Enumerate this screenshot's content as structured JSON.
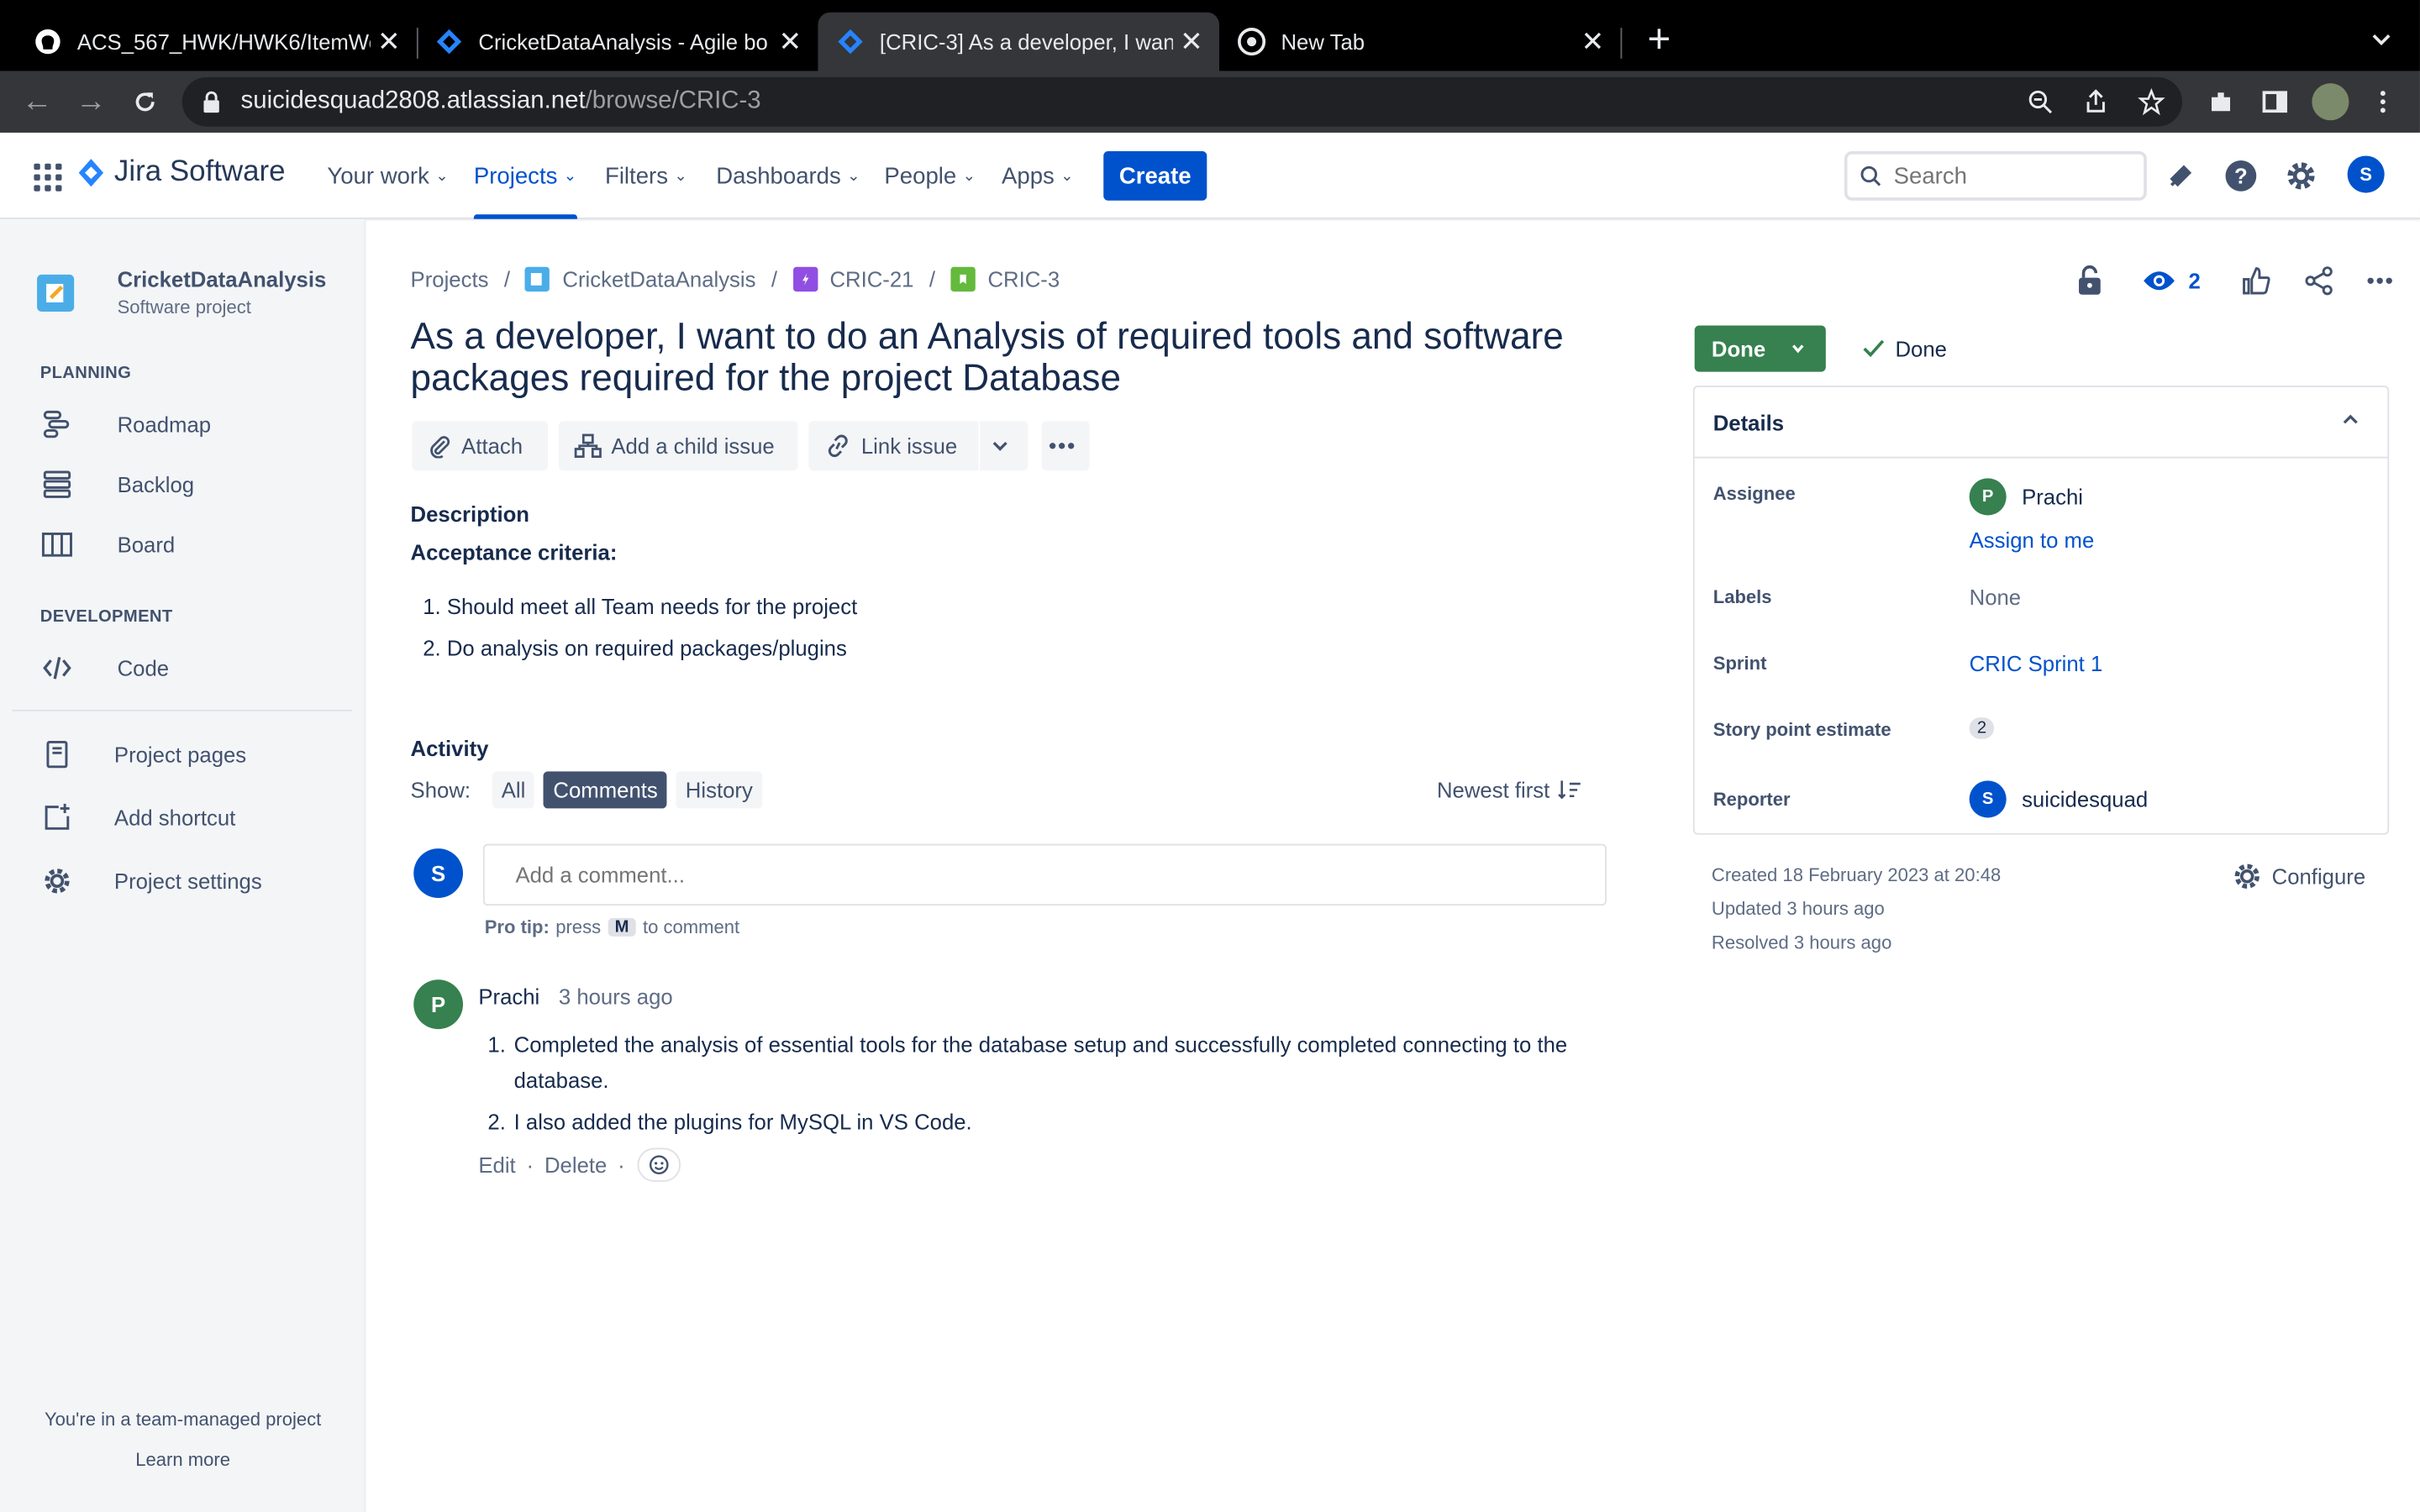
{
  "browser": {
    "tabs": [
      {
        "title": "ACS_567_HWK/HWK6/ItemWe",
        "icon": "github-icon"
      },
      {
        "title": "CricketDataAnalysis - Agile bo",
        "icon": "jira-icon"
      },
      {
        "title": "[CRIC-3] As a developer, I wan",
        "icon": "jira-icon",
        "active": true
      },
      {
        "title": "New Tab",
        "icon": "chrome-icon"
      }
    ],
    "url_host": "suicidesquad2808.atlassian.net",
    "url_path": "/browse/CRIC-3"
  },
  "topnav": {
    "product": "Jira Software",
    "items": [
      "Your work",
      "Projects",
      "Filters",
      "Dashboards",
      "People",
      "Apps"
    ],
    "create": "Create",
    "search_placeholder": "Search",
    "user_initial": "S"
  },
  "sidebar": {
    "project_name": "CricketDataAnalysis",
    "project_type": "Software project",
    "planning_header": "PLANNING",
    "planning": [
      "Roadmap",
      "Backlog",
      "Board"
    ],
    "development_header": "DEVELOPMENT",
    "development": [
      "Code"
    ],
    "links": [
      "Project pages",
      "Add shortcut",
      "Project settings"
    ],
    "footer_text": "You're in a team-managed project",
    "footer_link": "Learn more"
  },
  "issue": {
    "breadcrumbs": [
      "Projects",
      "CricketDataAnalysis",
      "CRIC-21",
      "CRIC-3"
    ],
    "title": "As a developer, I want to do an Analysis of required tools and software packages required for the project Database",
    "actions": [
      "Attach",
      "Add a child issue",
      "Link issue"
    ],
    "description_header": "Description",
    "acceptance": "Acceptance criteria:",
    "criteria": [
      "1. Should meet all Team needs for the project",
      "2. Do analysis on required packages/plugins"
    ],
    "watchers": "2",
    "status": "Done",
    "resolution": "Done"
  },
  "activity": {
    "header": "Activity",
    "show_label": "Show:",
    "filters": [
      "All",
      "Comments",
      "History"
    ],
    "active_filter": "Comments",
    "sort": "Newest first",
    "comment_placeholder": "Add a comment...",
    "protip_label": "Pro tip:",
    "protip_pre": "press",
    "protip_key": "M",
    "protip_post": "to comment",
    "comment": {
      "author": "Prachi",
      "author_initial": "P",
      "time": "3 hours ago",
      "items": [
        {
          "n": "1.",
          "text": "Completed the analysis of essential tools for the database setup and successfully completed connecting to the database."
        },
        {
          "n": "2.",
          "text": "I also added the plugins for MySQL in VS Code."
        }
      ],
      "edit": "Edit",
      "delete": "Delete"
    }
  },
  "details": {
    "header": "Details",
    "assignee_label": "Assignee",
    "assignee": "Prachi",
    "assignee_initial": "P",
    "assign_to_me": "Assign to me",
    "labels_label": "Labels",
    "labels": "None",
    "sprint_label": "Sprint",
    "sprint": "CRIC Sprint 1",
    "story_points_label": "Story point estimate",
    "story_points": "2",
    "reporter_label": "Reporter",
    "reporter": "suicidesquad",
    "reporter_initial": "S",
    "created": "Created 18 February 2023 at 20:48",
    "updated": "Updated 3 hours ago",
    "resolved": "Resolved 3 hours ago",
    "configure": "Configure"
  },
  "colors": {
    "brand": "#0052cc",
    "done": "#36814f",
    "avatar_p": "#36814f",
    "avatar_s": "#0052cc"
  }
}
